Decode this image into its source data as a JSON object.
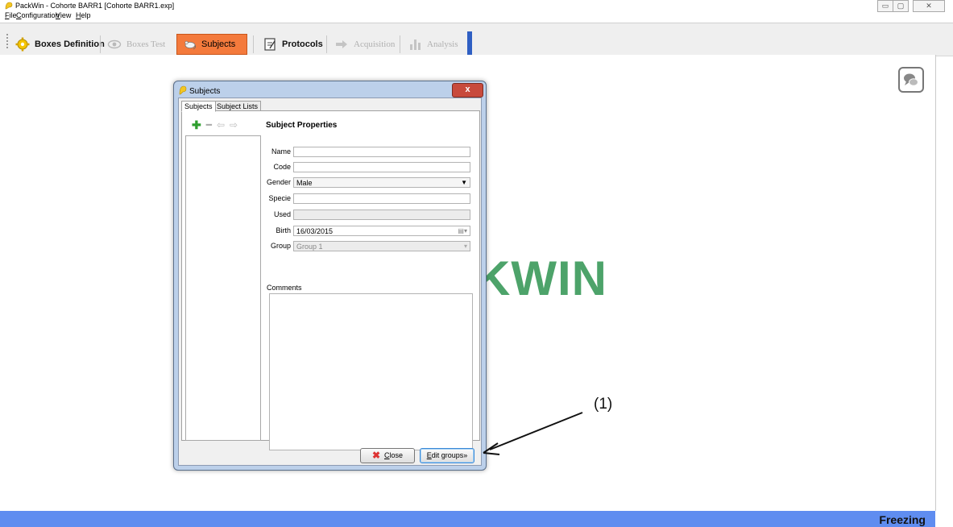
{
  "window": {
    "title": "PackWin - Cohorte BARR1 [Cohorte BARR1.exp]",
    "controls": [
      "▭",
      "▢",
      "✕"
    ]
  },
  "menu": [
    "File",
    "Configuration",
    "View",
    "Help"
  ],
  "toolbar": {
    "items": [
      {
        "label": "Boxes Definition",
        "state": "enabled",
        "icon": "gear-icon"
      },
      {
        "label": "Boxes Test",
        "state": "disabled",
        "icon": "eye-icon"
      },
      {
        "label": "Subjects",
        "state": "active",
        "icon": "mouse-icon"
      },
      {
        "label": "Protocols",
        "state": "enabled",
        "icon": "document-icon"
      },
      {
        "label": "Acquisition",
        "state": "disabled",
        "icon": "arrow-right-icon"
      },
      {
        "label": "Analysis",
        "state": "disabled",
        "icon": "chart-icon"
      }
    ]
  },
  "background_logo": "KWIN",
  "status": {
    "text": "Freezing"
  },
  "dialog": {
    "title": "Subjects",
    "tabs": [
      {
        "label": "Subjects",
        "selected": true
      },
      {
        "label": "Subject Lists",
        "selected": false
      }
    ],
    "section_title": "Subject Properties",
    "fields": {
      "name": {
        "label": "Name",
        "value": ""
      },
      "code": {
        "label": "Code",
        "value": ""
      },
      "gender": {
        "label": "Gender",
        "value": "Male"
      },
      "specie": {
        "label": "Specie",
        "value": ""
      },
      "used": {
        "label": "Used",
        "value": ""
      },
      "birth": {
        "label": "Birth",
        "value": "16/03/2015"
      },
      "group": {
        "label": "Group",
        "value": "Group 1"
      }
    },
    "comments_label": "Comments",
    "close_button": "Close",
    "edit_groups_button": "Edit groups»"
  },
  "annotation": {
    "label": "(1)"
  },
  "colors": {
    "active_tab": "#f47a3c",
    "status_bar": "#5f8df0",
    "logo_green": "#4da36a"
  }
}
